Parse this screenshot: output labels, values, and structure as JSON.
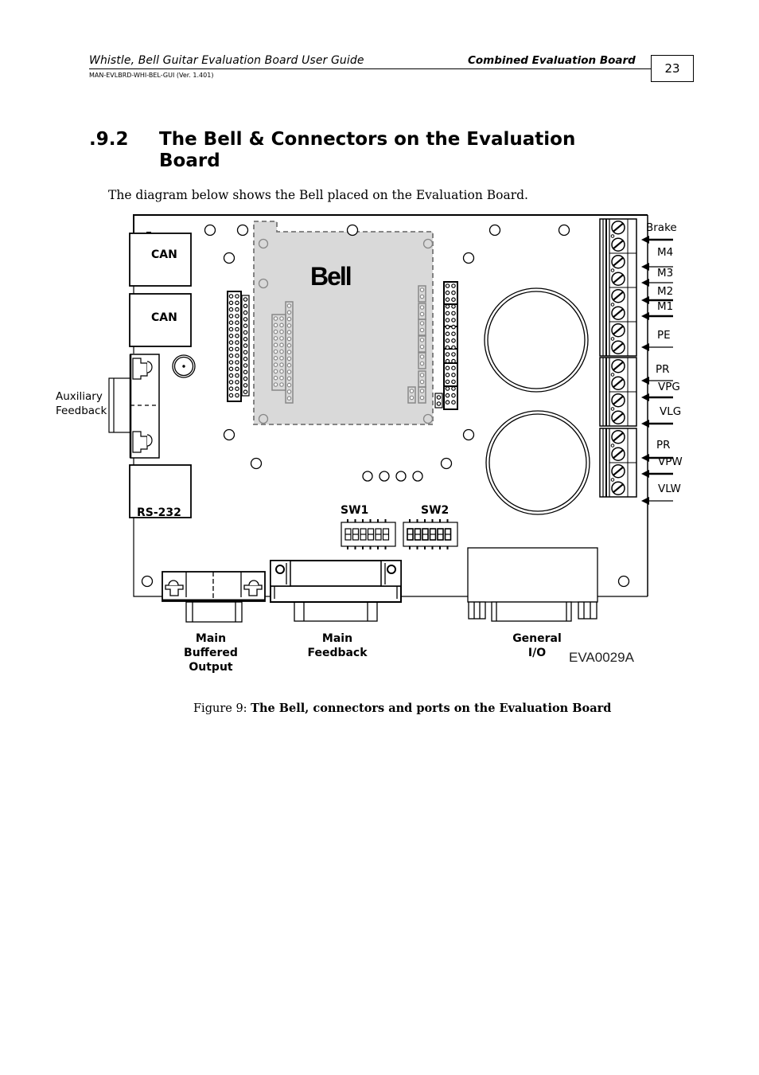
{
  "header": {
    "doc_title": "Whistle, Bell Guitar Evaluation Board User Guide",
    "section_name": "Combined Evaluation Board",
    "doc_id": "MAN-EVLBRD-WHI-BEL-GUI (Ver. 1.401)",
    "page_number": "23"
  },
  "section": {
    "number": ".9.2",
    "title": "The Bell & Connectors on the Evaluation Board",
    "intro": "The diagram below shows the Bell placed on the Evaluation Board."
  },
  "diagram": {
    "module_label": "Bell",
    "connectors_left": [
      {
        "label": "CAN"
      },
      {
        "label": "CAN"
      },
      {
        "label": "Auxiliary Feedback"
      },
      {
        "label": "RS-232"
      }
    ],
    "switches": [
      {
        "label": "SW1",
        "positions": 6
      },
      {
        "label": "SW2",
        "positions": 6
      }
    ],
    "terminal_labels": [
      "Brake",
      "M4",
      "M3",
      "M2",
      "M1",
      "PE",
      "PR",
      "VPG",
      "VLG",
      "PR",
      "VPW",
      "VLW"
    ],
    "bottom_connectors": [
      {
        "label": "Main Buffered Output",
        "lines": [
          "Main",
          "Buffered",
          "Output"
        ]
      },
      {
        "label": "Main Feedback",
        "lines": [
          "Main",
          "Feedback"
        ]
      },
      {
        "label": "General I/O",
        "lines": [
          "General",
          "I/O"
        ]
      }
    ],
    "figure_code": "EVA0029A"
  },
  "caption": {
    "prefix": "Figure 9: ",
    "text": "The Bell, connectors and ports on the Evaluation Board"
  }
}
